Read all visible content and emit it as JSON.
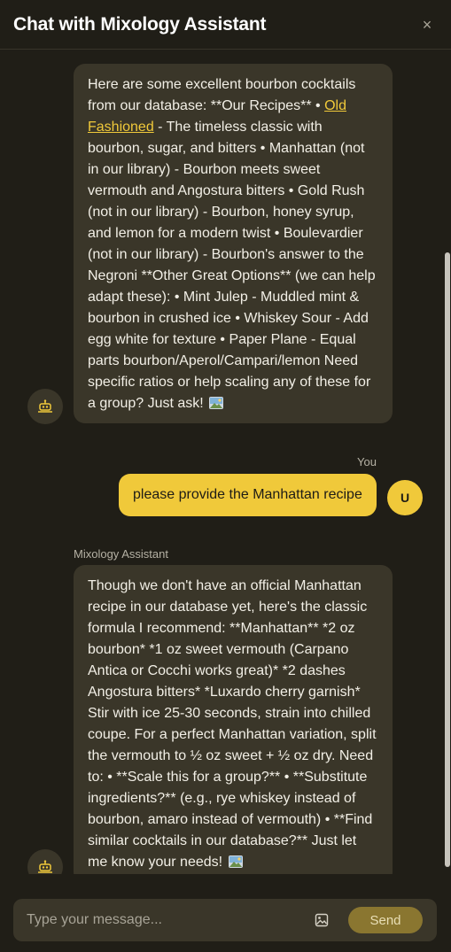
{
  "header": {
    "title": "Chat with Mixology Assistant",
    "close_label": "×"
  },
  "messages": [
    {
      "role": "assistant",
      "text_before_link": "Here are some excellent bourbon cocktails from our database: **Our Recipes** • ",
      "link_text": "Old Fashioned",
      "text_after_link": " - The timeless classic with bourbon, sugar, and bitters • Manhattan (not in our library) - Bourbon meets sweet vermouth and Angostura bitters • Gold Rush (not in our library) - Bourbon, honey syrup, and lemon for a modern twist • Boulevardier (not in our library) - Bourbon's answer to the Negroni **Other Great Options** (we can help adapt these): • Mint Julep - Muddled mint & bourbon in crushed ice • Whiskey Sour - Add egg white for texture • Paper Plane - Equal parts bourbon/Aperol/Campari/lemon Need specific ratios or help scaling any of these for a group? Just ask!"
    },
    {
      "role": "user",
      "sender": "You",
      "avatar_letter": "U",
      "text": "please provide the Manhattan recipe"
    },
    {
      "role": "assistant",
      "sender": "Mixology Assistant",
      "text": "Though we don't have an official Manhattan recipe in our database yet, here's the classic formula I recommend: **Manhattan** *2 oz bourbon* *1 oz sweet vermouth (Carpano Antica or Cocchi works great)* *2 dashes Angostura bitters* *Luxardo cherry garnish* Stir with ice 25-30 seconds, strain into chilled coupe. For a perfect Manhattan variation, split the vermouth to ½ oz sweet + ½ oz dry. Need to: • **Scale this for a group?** • **Substitute ingredients?** (e.g., rye whiskey instead of bourbon, amaro instead of vermouth) • **Find similar cocktails in our database?** Just let me know your needs!"
    }
  ],
  "composer": {
    "placeholder": "Type your message...",
    "send_label": "Send"
  },
  "icons": {
    "bot": "cocktail-bot-icon",
    "image_attach": "image-icon",
    "close": "close-icon"
  },
  "colors": {
    "accent": "#f0c93a",
    "bubble_dark": "#3a3629",
    "background": "#201e17",
    "send_button": "#8a7630"
  }
}
